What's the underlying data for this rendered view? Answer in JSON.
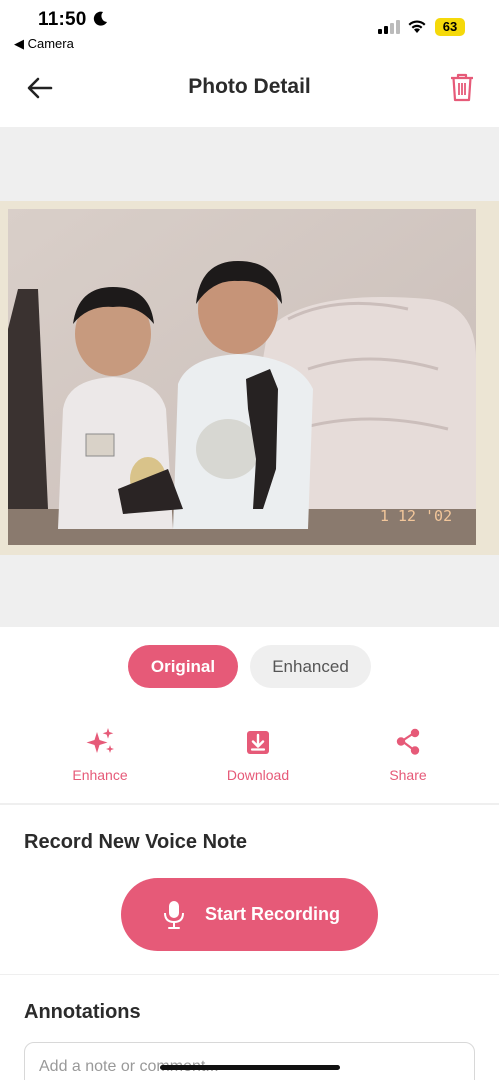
{
  "status_bar": {
    "time": "11:50",
    "back_app": "◀ Camera",
    "battery": "63"
  },
  "header": {
    "title": "Photo Detail"
  },
  "photo": {
    "date_stamp": "1 12 '02"
  },
  "view_toggle": {
    "original_label": "Original",
    "enhanced_label": "Enhanced",
    "selected": "Original"
  },
  "actions": {
    "enhance_label": "Enhance",
    "download_label": "Download",
    "share_label": "Share"
  },
  "voice_note": {
    "title": "Record New Voice Note",
    "button_label": "Start Recording"
  },
  "annotations": {
    "title": "Annotations",
    "placeholder": "Add a note or comment..."
  },
  "colors": {
    "accent": "#e65a78",
    "photo_bg": "#efefef"
  }
}
